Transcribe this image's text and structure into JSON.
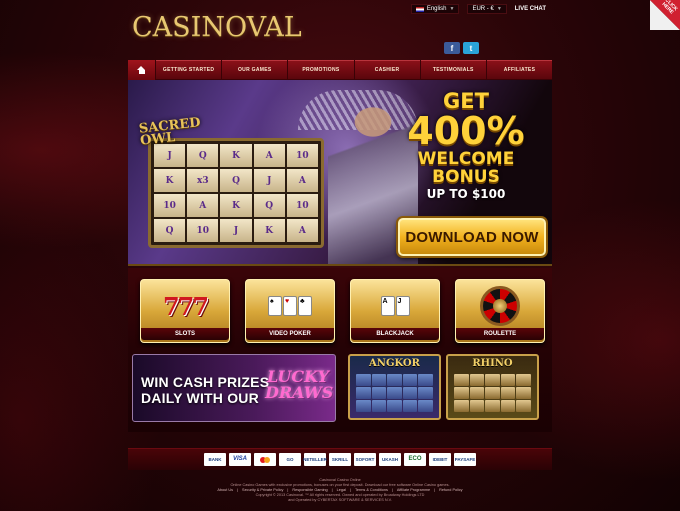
{
  "header": {
    "logo_text": "CASINOVAL",
    "language": "English",
    "currency": "EUR - €",
    "live_chat": "LIVE CHAT",
    "social": {
      "facebook": "f",
      "twitter": "t"
    },
    "corner_badge": "CLICK HERE"
  },
  "nav": {
    "items": [
      {
        "label": "GETTING STARTED"
      },
      {
        "label": "OUR GAMES"
      },
      {
        "label": "PROMOTIONS"
      },
      {
        "label": "CASHIER"
      },
      {
        "label": "TESTIMONIALS"
      },
      {
        "label": "AFFILIATES"
      }
    ]
  },
  "hero": {
    "slot_title": "SACRED OWL",
    "reel_symbols": [
      "J",
      "Q",
      "K",
      "A",
      "10",
      "K",
      "x3",
      "Q",
      "J",
      "A",
      "10",
      "A",
      "K",
      "Q",
      "10",
      "Q",
      "10",
      "J",
      "K",
      "A"
    ],
    "promo": {
      "line1": "GET",
      "line2": "400%",
      "line3": "WELCOME",
      "line4": "BONUS",
      "line5": "UP TO $100"
    },
    "download_button": "DOWNLOAD NOW"
  },
  "games": {
    "tiles": [
      {
        "label": "SLOTS",
        "art": "777"
      },
      {
        "label": "VIDEO POKER",
        "art": "cards"
      },
      {
        "label": "BLACKJACK",
        "art": "cards"
      },
      {
        "label": "ROULETTE",
        "art": "wheel"
      }
    ]
  },
  "promotions": {
    "lucky": {
      "line1": "WIN CASH PRIZES",
      "line2": "DAILY WITH OUR",
      "badge_line1": "LUCKY",
      "badge_line2": "DRAWS"
    },
    "thumbs": [
      {
        "name": "ANGKOR"
      },
      {
        "name": "RHINO"
      }
    ]
  },
  "payments": {
    "methods": [
      "BANK",
      "VISA",
      "MC",
      "GO",
      "NETELLER",
      "SKRILL",
      "SOFORT",
      "UKASH",
      "ECO",
      "IDEBIT",
      "PAYSAFE"
    ]
  },
  "footer": {
    "line1": "Casinoval Casino Online",
    "line2": "Online Casino Games with exclusive promotions, bonuses on your first deposit. Download our free software Online Casino games.",
    "links": [
      "About Us",
      "Security & Private Policy",
      "Responsible Gaming",
      "Legal",
      "Terms & Conditions",
      "Affiliate Programme",
      "Refund Policy"
    ],
    "line3": "Copyright © 2013 Casinoval. ™ All rights reserved. Owned and operated by Broadway Holdings LTD",
    "line4": "and Operated by CYBERTAX SOFTWARE & SERVICES N.V."
  }
}
